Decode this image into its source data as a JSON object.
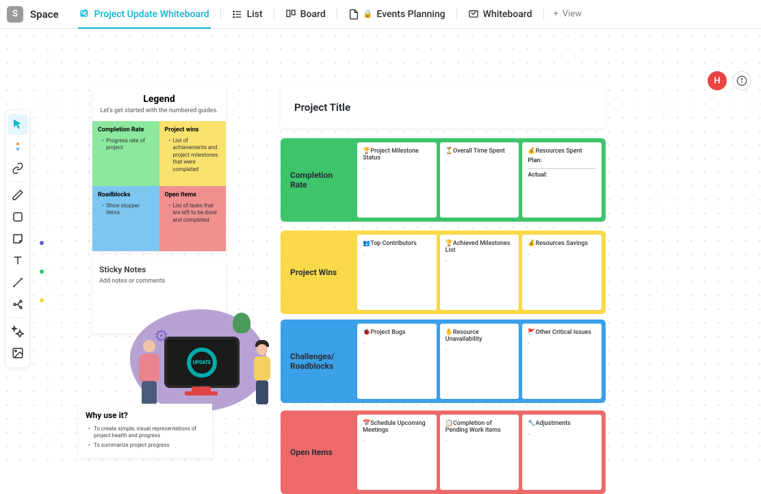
{
  "topbar": {
    "logo_letter": "S",
    "space": "Space",
    "tabs": [
      {
        "label": "Project Update Whiteboard",
        "icon": "whiteboard-edit",
        "active": true
      },
      {
        "label": "List",
        "icon": "list"
      },
      {
        "label": "Board",
        "icon": "board"
      },
      {
        "label": "Events Planning",
        "icon": "doc",
        "locked": true
      },
      {
        "label": "Whiteboard",
        "icon": "whiteboard"
      }
    ],
    "add_view": "View"
  },
  "topright": {
    "avatar_letter": "H"
  },
  "legend": {
    "title": "Legend",
    "subtitle": "Let's get started with the numbered guides.",
    "cells": {
      "completion": {
        "title": "Completion Rate",
        "items": [
          "Progress rate of project"
        ]
      },
      "wins": {
        "title": "Project wins",
        "items": [
          "List of achievements and project milestones that were completed"
        ]
      },
      "roadblocks": {
        "title": "Roadblocks",
        "items": [
          "Show stopper items"
        ]
      },
      "open": {
        "title": "Open Items",
        "items": [
          "List of tasks that are left to be done and completed"
        ]
      }
    }
  },
  "sticky": {
    "title": "Sticky Notes",
    "text": "Add notes or comments"
  },
  "why": {
    "title": "Why use it?",
    "items": [
      "To create simple, visual representations of project health and progress",
      "To summarize project progress"
    ]
  },
  "illus": {
    "ring_text": "UPDATE"
  },
  "project": {
    "title": "Project Title"
  },
  "sections": [
    {
      "id": "completion",
      "label": "Completion Rate",
      "color": "green",
      "cards": [
        {
          "title": "🏆Project Milestone Status",
          "bullet": "."
        },
        {
          "title": "⏳Overall Time Spent",
          "bullet": "."
        },
        {
          "title": "💰Resources Spent",
          "plan": "Plan:",
          "actual": "Actual:"
        }
      ]
    },
    {
      "id": "wins",
      "label": "Project Wins",
      "color": "yellow",
      "cards": [
        {
          "title": "👥Top Contributors",
          "bullet": "."
        },
        {
          "title": "🏆Achieved Milestones List",
          "bullet": "."
        },
        {
          "title": "💰Resources Savings",
          "bullet": "."
        }
      ]
    },
    {
      "id": "challenges",
      "label": "Challenges/ Roadblocks",
      "color": "blue",
      "cards": [
        {
          "title": "🐞Project Bugs",
          "bullet": "."
        },
        {
          "title": "✋Resource Unavailability",
          "bullet": "."
        },
        {
          "title": "🚩Other Critical Issues",
          "bullet": "."
        }
      ]
    },
    {
      "id": "open",
      "label": "Open Items",
      "color": "red",
      "cards": [
        {
          "title": "📅Schedule Upcoming Meetings",
          "bullet": "."
        },
        {
          "title": "📋Completion of Pending Work Items",
          "bullet": "."
        },
        {
          "title": "🔧Adjustments",
          "bullet": "."
        }
      ]
    }
  ]
}
